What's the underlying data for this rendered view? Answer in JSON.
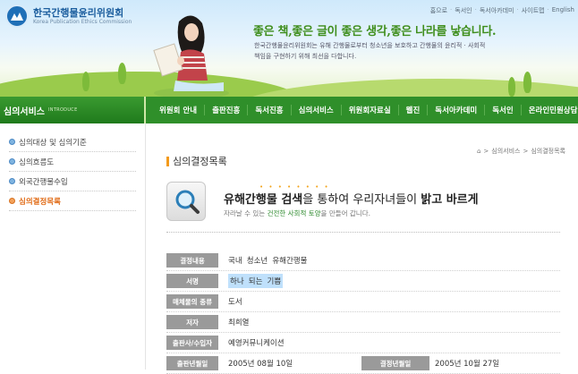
{
  "header": {
    "org_name": "한국간행물윤리위원회",
    "org_name_en": "Korea Publication Ethics Commission",
    "top_links": [
      "홈으로",
      "독서인",
      "독서아카데미",
      "사이트맵",
      "English"
    ],
    "slogan": "좋은 책,좋은 글이 좋은 생각,좋은 나라를 낳습니다.",
    "intro": "한국간행물윤리위원회는 유해 간행물로부터 청소년을 보호하고 간행물의 윤리적 · 사회적 책임을 구현하기 위해 최선을 다합니다."
  },
  "nav": {
    "section_title": "심의서비스",
    "section_sub": "INTRODUCE",
    "menu": [
      "위원회 안내",
      "출판진흥",
      "독서진흥",
      "심의서비스",
      "위원회자료실",
      "웹진",
      "독서아카데미",
      "독서인",
      "온라인민원상담"
    ]
  },
  "sidebar": {
    "items": [
      {
        "label": "심의대상 및 심의기준"
      },
      {
        "label": "심의흐름도"
      },
      {
        "label": "외국간행물수입"
      },
      {
        "label": "심의결정목록"
      }
    ]
  },
  "breadcrumb": [
    "심의서비스",
    "심의결정목록"
  ],
  "page_title": "심의결정목록",
  "hero": {
    "dots": "• • • • • • • •",
    "headline_part1": "유해간행물 검색",
    "headline_part2": "을 통하여 우리자녀들이 ",
    "headline_part3": "밝고 바르게",
    "sub_part1": "자라날 수 있는 ",
    "sub_highlight": "건전한 사회적 토양",
    "sub_part2": "을 만들어 갑니다."
  },
  "record": {
    "rows": [
      {
        "label": "결정내용",
        "value": "국내 청소년 유해간행물"
      },
      {
        "label": "서명",
        "value": "하나 되는 기쁨"
      },
      {
        "label": "매체물의 종류",
        "value": "도서"
      },
      {
        "label": "저자",
        "value": "최희열"
      },
      {
        "label": "출판사/수입자",
        "value": "예영커뮤니케이션"
      }
    ],
    "last_row": {
      "label": "출판년월일",
      "value": "2005년 08월 10일",
      "label2": "결정년월일",
      "value2": "2005년 10월 27일"
    }
  },
  "colors": {
    "nav_green": "#2f8f2a",
    "accent_orange": "#e06a14",
    "slogan_green": "#3f8e1c",
    "label_gray": "#9a9a9a"
  }
}
